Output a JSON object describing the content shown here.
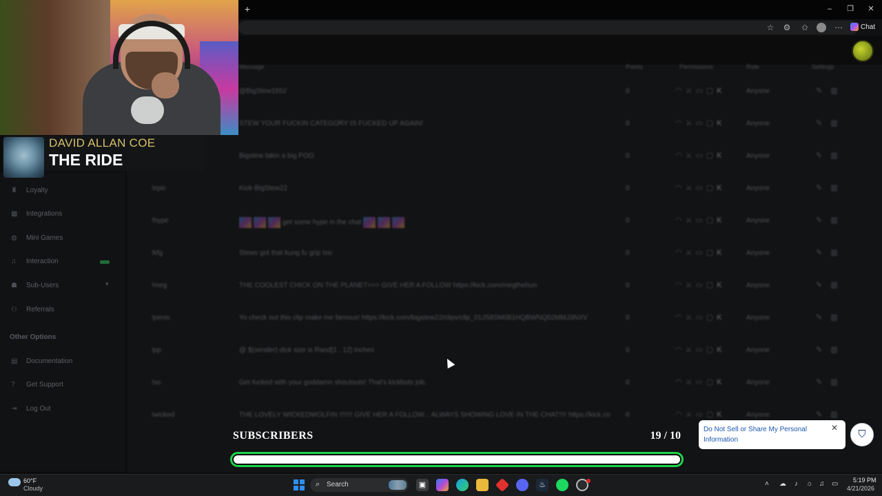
{
  "browser": {
    "new_tab": "+",
    "window_controls": [
      "–",
      "❐",
      "✕"
    ],
    "toolbar_icons": [
      "star-icon",
      "extensions-icon",
      "favorites-icon",
      "profile-icon",
      "more-icon"
    ],
    "chat_label": "Chat"
  },
  "now_playing": {
    "artist": "DAVID ALLAN COE",
    "song": "THE RIDE"
  },
  "table": {
    "headers": {
      "message": "Message",
      "points": "Points",
      "permissions": "Permissions",
      "role": "Role",
      "settings": "Settings"
    },
    "rows": [
      {
        "command": "",
        "message": "@BigStew1552",
        "points": "0",
        "role": "Anyone"
      },
      {
        "command": "",
        "message": "STEW YOUR FUCKIN CATEGORY IS FUCKED UP AGAIN!",
        "points": "0",
        "role": "Anyone"
      },
      {
        "command": "",
        "message": "Bigstew takin a big POO",
        "points": "0",
        "role": "Anyone"
      },
      {
        "command": "!epic",
        "message": "Kick-BigStew22",
        "points": "0",
        "role": "Anyone"
      },
      {
        "command": "!hype",
        "message": "get some hype in the chat",
        "points": "0",
        "role": "Anyone",
        "emotes": true
      },
      {
        "command": "!kfg",
        "message": "Stews got that kung fu grip too",
        "points": "0",
        "role": "Anyone"
      },
      {
        "command": "!meg",
        "message": "THE COOLEST CHICK ON THE PLANET>>> GIVE HER A FOLLOW https://kick.com/megthehun",
        "points": "0",
        "role": "Anyone"
      },
      {
        "command": "!penis",
        "message": "Yo check out this clip make me famous! https://kick.com/bigstew22/clips/clip_01JS8SM081HQBWNQ02MMJ3NXV",
        "points": "0",
        "role": "Anyone"
      },
      {
        "command": "!pp",
        "message": "@ $(sender) dick size is Rand[1 , 12] inches",
        "points": "0",
        "role": "Anyone"
      },
      {
        "command": "!so",
        "message": "Get fucked with your goddamn shoutouts! That's kickbots job.",
        "points": "0",
        "role": "Anyone"
      },
      {
        "command": "!wicked",
        "message": "THE LOVELY WICKEDWOLFIN !!!!!!! GIVE HER A FOLLOW... ALWAYS SHOWING LOVE IN THE CHAT!!!! https://kick.co",
        "points": "0",
        "role": "Anyone"
      }
    ]
  },
  "sidebar": {
    "items": [
      {
        "label": "Loyalty",
        "icon": "trophy-icon"
      },
      {
        "label": "Integrations",
        "icon": "grid-icon"
      },
      {
        "label": "Mini Games",
        "icon": "gamepad-icon"
      },
      {
        "label": "Interaction",
        "icon": "music-icon"
      },
      {
        "label": "Sub-Users",
        "icon": "users-icon"
      },
      {
        "label": "Referrals",
        "icon": "referral-icon"
      }
    ],
    "other_heading": "Other Options",
    "other_items": [
      {
        "label": "Documentation",
        "icon": "doc-icon"
      },
      {
        "label": "Get Support",
        "icon": "help-icon"
      },
      {
        "label": "Log Out",
        "icon": "logout-icon"
      }
    ]
  },
  "subscriber_goal": {
    "label": "SUBSCRIBERS",
    "count": "19 / 10",
    "progress": 1.0,
    "accent": "#1cd34a"
  },
  "privacy_toast": {
    "text": "Do Not Sell or Share My Personal Information",
    "close": "✕",
    "shield": "⛉"
  },
  "taskbar": {
    "weather_temp": "60°F",
    "weather_cond": "Cloudy",
    "search_label": "Search",
    "time": "5:19 PM",
    "date": "4/21/2026"
  }
}
